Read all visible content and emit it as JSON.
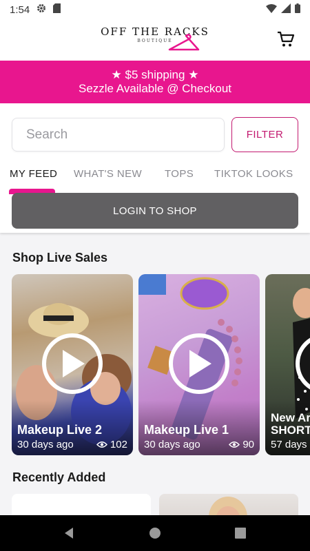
{
  "status": {
    "time": "1:54"
  },
  "logo": {
    "name": "OFF THE RACKS",
    "sub": "BOUTIQUE"
  },
  "promo": {
    "line1": "★ $5 shipping ★",
    "line2": "Sezzle Available @ Checkout"
  },
  "search": {
    "placeholder": "Search",
    "filter_label": "FILTER"
  },
  "tabs": [
    {
      "label": "MY FEED",
      "active": true
    },
    {
      "label": "WHAT'S NEW",
      "active": false
    },
    {
      "label": "TOPS",
      "active": false
    },
    {
      "label": "TIKTOK LOOKS",
      "active": false
    }
  ],
  "login": {
    "label": "LOGIN TO SHOP"
  },
  "sections": {
    "live": "Shop Live Sales",
    "recent": "Recently Added"
  },
  "live_sales": [
    {
      "title": "Makeup Live 2",
      "age": "30 days ago",
      "views": "102"
    },
    {
      "title": "Makeup Live 1",
      "age": "30 days ago",
      "views": "90"
    },
    {
      "title": "New Ar",
      "title2": "SHORT",
      "age": "57 days"
    }
  ],
  "colors": {
    "brand_pink": "#e8168e",
    "filter_pink": "#c2186f",
    "login_gray": "#616062"
  }
}
